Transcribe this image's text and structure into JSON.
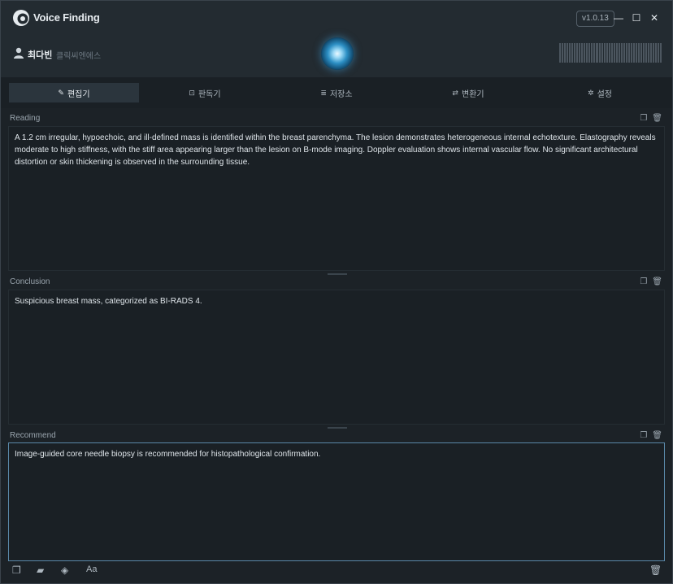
{
  "app": {
    "title": "Voice Finding",
    "version": "v1.0.13"
  },
  "window_controls": {
    "minimize": "—",
    "maximize": "☐",
    "close": "✕"
  },
  "user": {
    "name": "최다빈",
    "org": "클릭씨엔에스"
  },
  "tabs": [
    {
      "label": "편집기",
      "icon": "edit-icon",
      "active": true
    },
    {
      "label": "판독기",
      "icon": "scan-icon",
      "active": false
    },
    {
      "label": "저장소",
      "icon": "database-icon",
      "active": false
    },
    {
      "label": "변환기",
      "icon": "exchange-icon",
      "active": false
    },
    {
      "label": "설정",
      "icon": "gear-icon",
      "active": false
    }
  ],
  "sections": {
    "reading": {
      "label": "Reading",
      "text": "A 1.2 cm irregular, hypoechoic, and ill-defined mass is identified within the breast parenchyma. The lesion demonstrates heterogeneous internal echotexture. Elastography reveals moderate to high stiffness, with the stiff area appearing larger than the lesion on B-mode imaging. Doppler evaluation shows internal vascular flow. No significant architectural distortion or skin thickening is observed in the surrounding tissue."
    },
    "conclusion": {
      "label": "Conclusion",
      "text": "Suspicious breast mass, categorized as BI-RADS 4."
    },
    "recommend": {
      "label": "Recommend",
      "text": "Image-guided core needle biopsy is recommended for histopathological confirmation."
    }
  },
  "colors": {
    "accent": "#5a88a8",
    "background": "#1c2227",
    "orb": "#2c8fc4"
  }
}
